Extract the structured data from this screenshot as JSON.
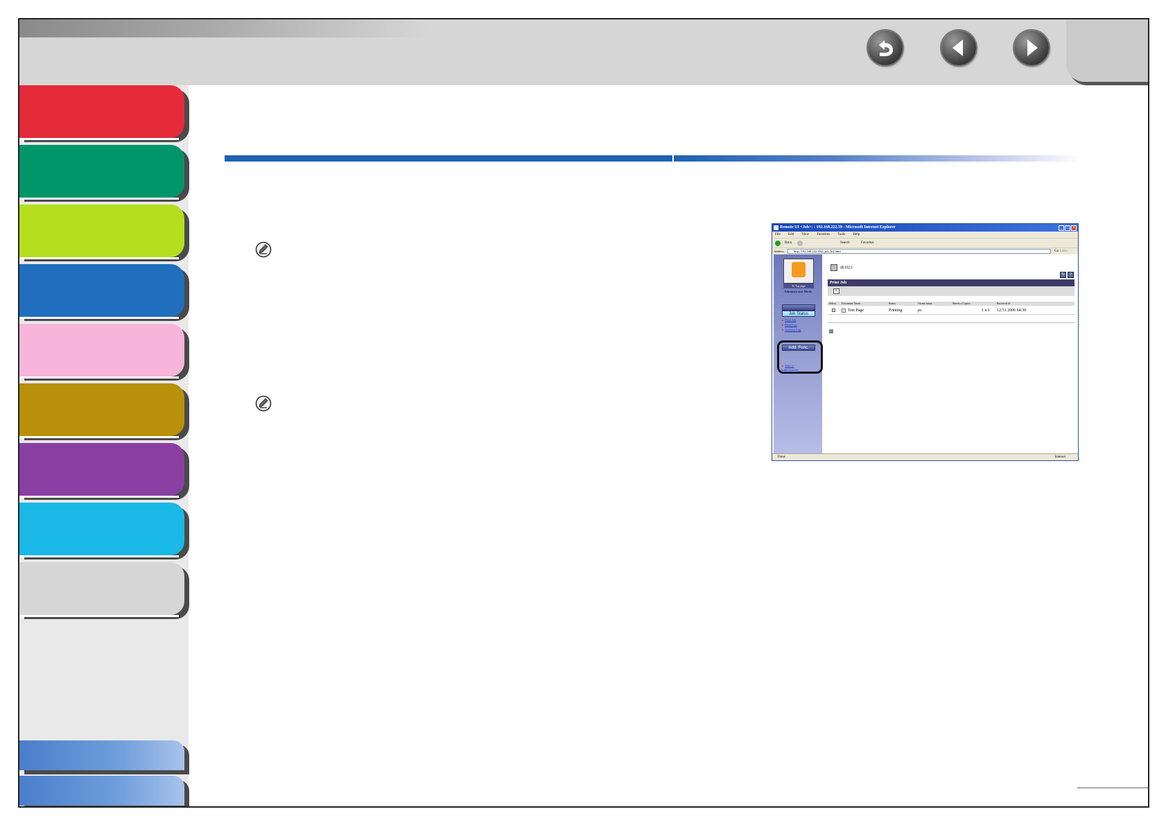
{
  "colors": {
    "chapter_tabs": [
      "#e52a3a",
      "#00966a",
      "#b5de1f",
      "#1f6fbe",
      "#f7b5dc",
      "#b8900a",
      "#8a3fa3",
      "#1ab8e6",
      "#d6d6d6"
    ],
    "rule_blue": "#1f62b0"
  },
  "nav": {
    "back_icon": "back-icon",
    "previous_icon": "previous-page-icon",
    "next_icon": "next-page-icon"
  },
  "screenshot": {
    "window_title": "Remote UI <Job>: : 192.168.222.59 - Microsoft Internet Explorer",
    "menu": [
      "File",
      "Edit",
      "View",
      "Favorites",
      "Tools",
      "Help"
    ],
    "toolbar": {
      "back": "Back",
      "search": "Search",
      "favorites": "Favorites"
    },
    "address_label": "Address",
    "address_value": "http://192.168.222.59/jl_job_list.html",
    "go_label": "Go",
    "links_label": "Links",
    "to_top_page": "To Top page",
    "mode": "Administrator Mode",
    "job_status_button": "Job Status",
    "links": [
      "Print Job",
      "Print Log",
      "Activity Log"
    ],
    "add_func_button": "Add. Func.",
    "extra_links": [
      "Mail to",
      "Administrator"
    ],
    "device_name": "iR1023",
    "section_title": "Print Job",
    "table": {
      "headers": [
        "Select",
        "Document Name",
        "Status",
        "Owner name",
        "Sheets x Copies",
        "Received At"
      ],
      "row": {
        "document": "Test Page",
        "status": "Printing",
        "owner": "pc",
        "copies": "1 x 1",
        "received": "12/31 2006 04:30"
      }
    },
    "status_done": "Done",
    "status_zone": "Internet"
  }
}
